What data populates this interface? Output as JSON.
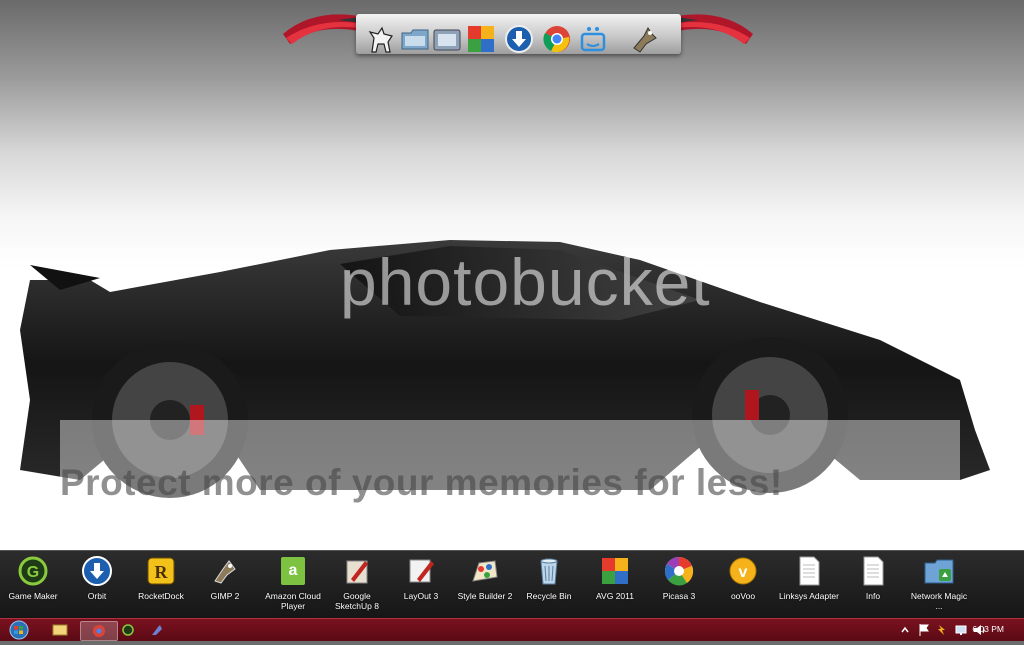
{
  "top_dock": {
    "icons": [
      {
        "name": "unicorn-icon"
      },
      {
        "name": "folder-icon"
      },
      {
        "name": "screenshot-icon"
      },
      {
        "name": "avg-icon"
      },
      {
        "name": "orbit-download-icon"
      },
      {
        "name": "chrome-icon"
      },
      {
        "name": "robot-face-icon"
      },
      {
        "name": "gimp-icon"
      }
    ]
  },
  "watermark": {
    "logo": "photobucket",
    "text": "Protect more of your memories for less!"
  },
  "bottom_dock": {
    "items": [
      {
        "label": "Game Maker",
        "icon": "game-maker-icon"
      },
      {
        "label": "Orbit",
        "icon": "orbit-icon"
      },
      {
        "label": "RocketDock",
        "icon": "rocketdock-icon"
      },
      {
        "label": "GIMP 2",
        "icon": "gimp-icon"
      },
      {
        "label": "Amazon Cloud Player",
        "icon": "amazon-icon"
      },
      {
        "label": "Google SketchUp 8",
        "icon": "sketchup-icon"
      },
      {
        "label": "LayOut 3",
        "icon": "layout-icon"
      },
      {
        "label": "Style Builder 2",
        "icon": "style-builder-icon"
      },
      {
        "label": "Recycle Bin",
        "icon": "recycle-bin-icon"
      },
      {
        "label": "AVG 2011",
        "icon": "avg-icon"
      },
      {
        "label": "Picasa 3",
        "icon": "picasa-icon"
      },
      {
        "label": "ooVoo",
        "icon": "oovoo-icon"
      },
      {
        "label": "Linksys Adapter",
        "icon": "document-icon"
      },
      {
        "label": "Info",
        "icon": "document-icon"
      },
      {
        "label": "Network Magic ...",
        "icon": "network-magic-icon"
      }
    ]
  },
  "taskbar": {
    "clock": "6:03 PM",
    "buttons": [
      {
        "name": "explorer-icon"
      },
      {
        "name": "chrome-icon"
      },
      {
        "name": "game-maker-icon"
      },
      {
        "name": "gimp-icon"
      }
    ]
  }
}
